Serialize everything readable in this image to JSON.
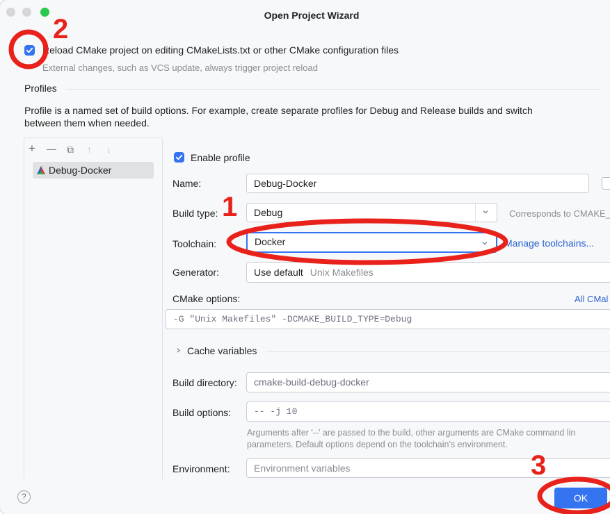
{
  "window": {
    "title": "Open Project Wizard"
  },
  "reload": {
    "label": "Reload CMake project on editing CMakeLists.txt or other CMake configuration files",
    "hint": "External changes, such as VCS update, always trigger project reload"
  },
  "profiles": {
    "heading": "Profiles",
    "description_1": "Profile is a named set of build options. For example, create separate profiles for Debug and Release builds and switch",
    "description_2": "between them when needed.",
    "items": [
      {
        "label": "Debug-Docker"
      }
    ]
  },
  "toolbar": {
    "add": "+",
    "remove": "—",
    "copy": "⧉",
    "up": "↑",
    "down": "↓"
  },
  "form": {
    "enable_profile": "Enable profile",
    "name_label": "Name:",
    "name_value": "Debug-Docker",
    "build_type_label": "Build type:",
    "build_type_value": "Debug",
    "build_type_hint": "Corresponds to CMAKE_",
    "toolchain_label": "Toolchain:",
    "toolchain_value": "Docker",
    "manage_toolchains": "Manage toolchains...",
    "generator_label": "Generator:",
    "generator_value": "Use default",
    "generator_hint": "Unix Makefiles",
    "cmake_options_label": "CMake options:",
    "all_cmake_link": "All CMal",
    "cmake_options_value": "-G \"Unix Makefiles\" -DCMAKE_BUILD_TYPE=Debug",
    "cache_variables": "Cache variables",
    "build_dir_label": "Build directory:",
    "build_dir_value": "cmake-build-debug-docker",
    "build_options_label": "Build options:",
    "build_options_value": "-- -j 10",
    "build_options_hint_1": "Arguments after '--' are passed to the build, other arguments are CMake command lin",
    "build_options_hint_2": "parameters. Default options depend on the toolchain's environment.",
    "environment_label": "Environment:",
    "environment_placeholder": "Environment variables"
  },
  "footer": {
    "help": "?",
    "ok": "OK"
  },
  "annotations": {
    "one": "1",
    "two": "2",
    "three": "3",
    "color": "#e8221b"
  },
  "colors": {
    "accent": "#3574f0",
    "link": "#2a62cf"
  }
}
